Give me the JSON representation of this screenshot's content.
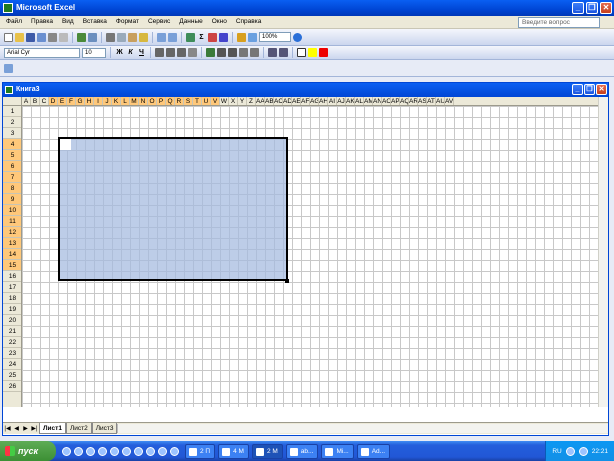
{
  "app": {
    "title": "Microsoft Excel",
    "menu": [
      "Файл",
      "Правка",
      "Вид",
      "Вставка",
      "Формат",
      "Сервис",
      "Данные",
      "Окно",
      "Справка"
    ],
    "ask_placeholder": "Введите вопрос",
    "zoom": "100%",
    "font_name": "Arial Cyr",
    "font_size": "10",
    "format_buttons": [
      "Ж",
      "К",
      "Ч"
    ]
  },
  "workbook": {
    "title": "Книга3",
    "columns": [
      "A",
      "B",
      "C",
      "D",
      "E",
      "F",
      "G",
      "H",
      "I",
      "J",
      "K",
      "L",
      "M",
      "N",
      "O",
      "P",
      "Q",
      "R",
      "S",
      "T",
      "U",
      "V",
      "W",
      "X",
      "Y",
      "Z",
      "AA",
      "AB",
      "AC",
      "AD",
      "AE",
      "AF",
      "AG",
      "AH",
      "AI",
      "AJ",
      "AK",
      "AL",
      "AM",
      "AN",
      "AO",
      "AP",
      "AQ",
      "AR",
      "AS",
      "AT",
      "AU",
      "AV"
    ],
    "rows": [
      "1",
      "2",
      "3",
      "4",
      "5",
      "6",
      "7",
      "8",
      "9",
      "10",
      "11",
      "12",
      "13",
      "14",
      "15",
      "16",
      "17",
      "18",
      "19",
      "20",
      "21",
      "22",
      "23",
      "24",
      "25",
      "26"
    ],
    "selection": "D4:V15",
    "sheets": [
      "Лист1",
      "Лист2",
      "Лист3"
    ],
    "active_sheet": "Лист1"
  },
  "taskbar": {
    "start_label": "пуск",
    "tasks": [
      "2 П",
      "4 М",
      "2 М",
      "ab...",
      "Mi...",
      "Ad..."
    ],
    "lang": "RU",
    "clock": "22:21"
  },
  "colors": {
    "title_blue": "#0046d5",
    "selection": "#a4badf",
    "header_highlight": "#ffc87a",
    "start_green": "#3c8f34"
  }
}
